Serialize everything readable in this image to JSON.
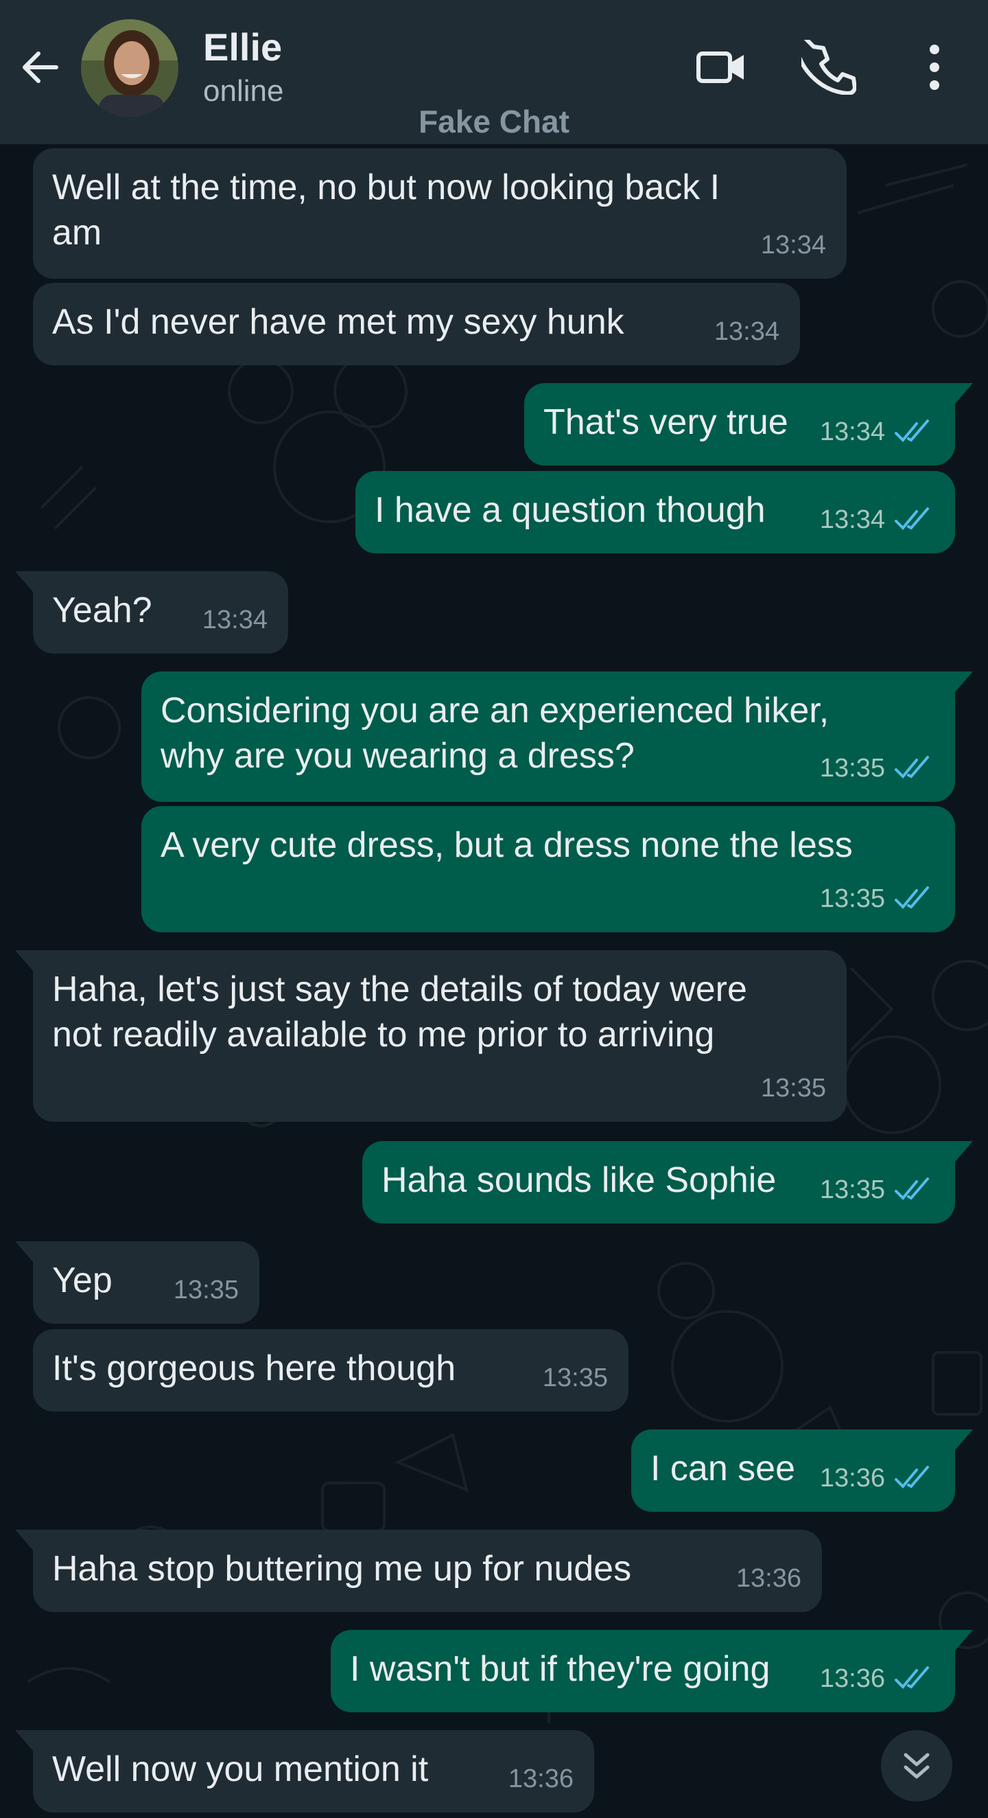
{
  "header": {
    "contact_name": "Ellie",
    "contact_status": "online",
    "watermark": "Fake Chat",
    "icons": [
      "arrow-left-icon",
      "video-call-icon",
      "phone-icon",
      "more-vertical-icon"
    ]
  },
  "colors": {
    "background": "#0b141a",
    "header": "#1f2c34",
    "incoming_bubble": "#202c33",
    "outgoing_bubble": "#005c4b",
    "read_ticks": "#53bdeb",
    "text": "#e9edef",
    "meta_text": "#8696a0"
  },
  "messages": [
    {
      "dir": "in",
      "text": "Well at the time, no but now looking back I\nam",
      "time": "13:34"
    },
    {
      "dir": "in",
      "text": "As I'd never have met my sexy hunk",
      "time": "13:34"
    },
    {
      "dir": "out",
      "text": "That's very true",
      "time": "13:34",
      "status": "read"
    },
    {
      "dir": "out",
      "text": "I have a question though",
      "time": "13:34",
      "status": "read"
    },
    {
      "dir": "in",
      "text": "Yeah?",
      "time": "13:34"
    },
    {
      "dir": "out",
      "text": "Considering you are an experienced hiker,\nwhy are you wearing a dress?",
      "time": "13:35",
      "status": "read"
    },
    {
      "dir": "out",
      "text": "A very cute dress, but a dress none the less",
      "time": "13:35",
      "status": "read"
    },
    {
      "dir": "in",
      "text": "Haha, let's just say the details of today were\nnot readily available to me prior to arriving",
      "time": "13:35"
    },
    {
      "dir": "out",
      "text": "Haha sounds like Sophie",
      "time": "13:35",
      "status": "read"
    },
    {
      "dir": "in",
      "text": "Yep",
      "time": "13:35"
    },
    {
      "dir": "in",
      "text": "It's gorgeous here though",
      "time": "13:35"
    },
    {
      "dir": "out",
      "text": "I can see",
      "time": "13:36",
      "status": "read"
    },
    {
      "dir": "in",
      "text": "Haha stop buttering me up for nudes",
      "time": "13:36"
    },
    {
      "dir": "out",
      "text": "I wasn't but if they're going",
      "time": "13:36",
      "status": "read"
    },
    {
      "dir": "in",
      "text": "Well now you mention it",
      "time": "13:36"
    }
  ],
  "scroll_button_icon": "chevrons-down-icon"
}
